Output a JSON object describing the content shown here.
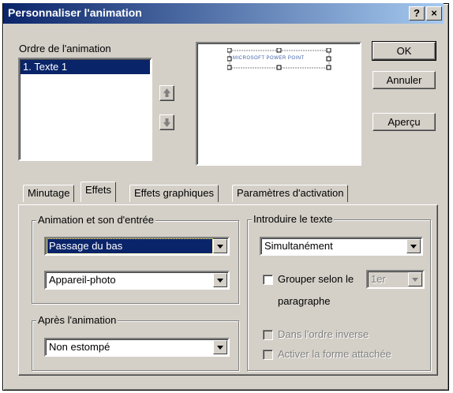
{
  "dialog": {
    "title": "Personnaliser l'animation",
    "help_btn": "?",
    "close_btn": "×"
  },
  "order": {
    "label": "Ordre de l'animation",
    "items": [
      "1. Texte 1"
    ]
  },
  "preview": {
    "placeholder_text": "MICROSOFT POWER POINT"
  },
  "buttons": {
    "ok": "OK",
    "cancel": "Annuler",
    "preview": "Aperçu"
  },
  "tabs": [
    {
      "label": "Minutage"
    },
    {
      "label": "Effets"
    },
    {
      "label": "Effets graphiques"
    },
    {
      "label": "Paramètres d'activation"
    }
  ],
  "entry": {
    "group_label": "Animation et son d'entrée",
    "effect_value": "Passage du bas",
    "sound_value": "Appareil-photo"
  },
  "after": {
    "group_label": "Après l'animation",
    "value": "Non estompé"
  },
  "introduce": {
    "group_label": "Introduire le texte",
    "value": "Simultanément",
    "group_by_label": "Grouper selon le",
    "level_value": "1er",
    "paragraph_label": "paragraphe",
    "reverse_label": "Dans l'ordre inverse",
    "attached_label": "Activer la forme attachée"
  }
}
